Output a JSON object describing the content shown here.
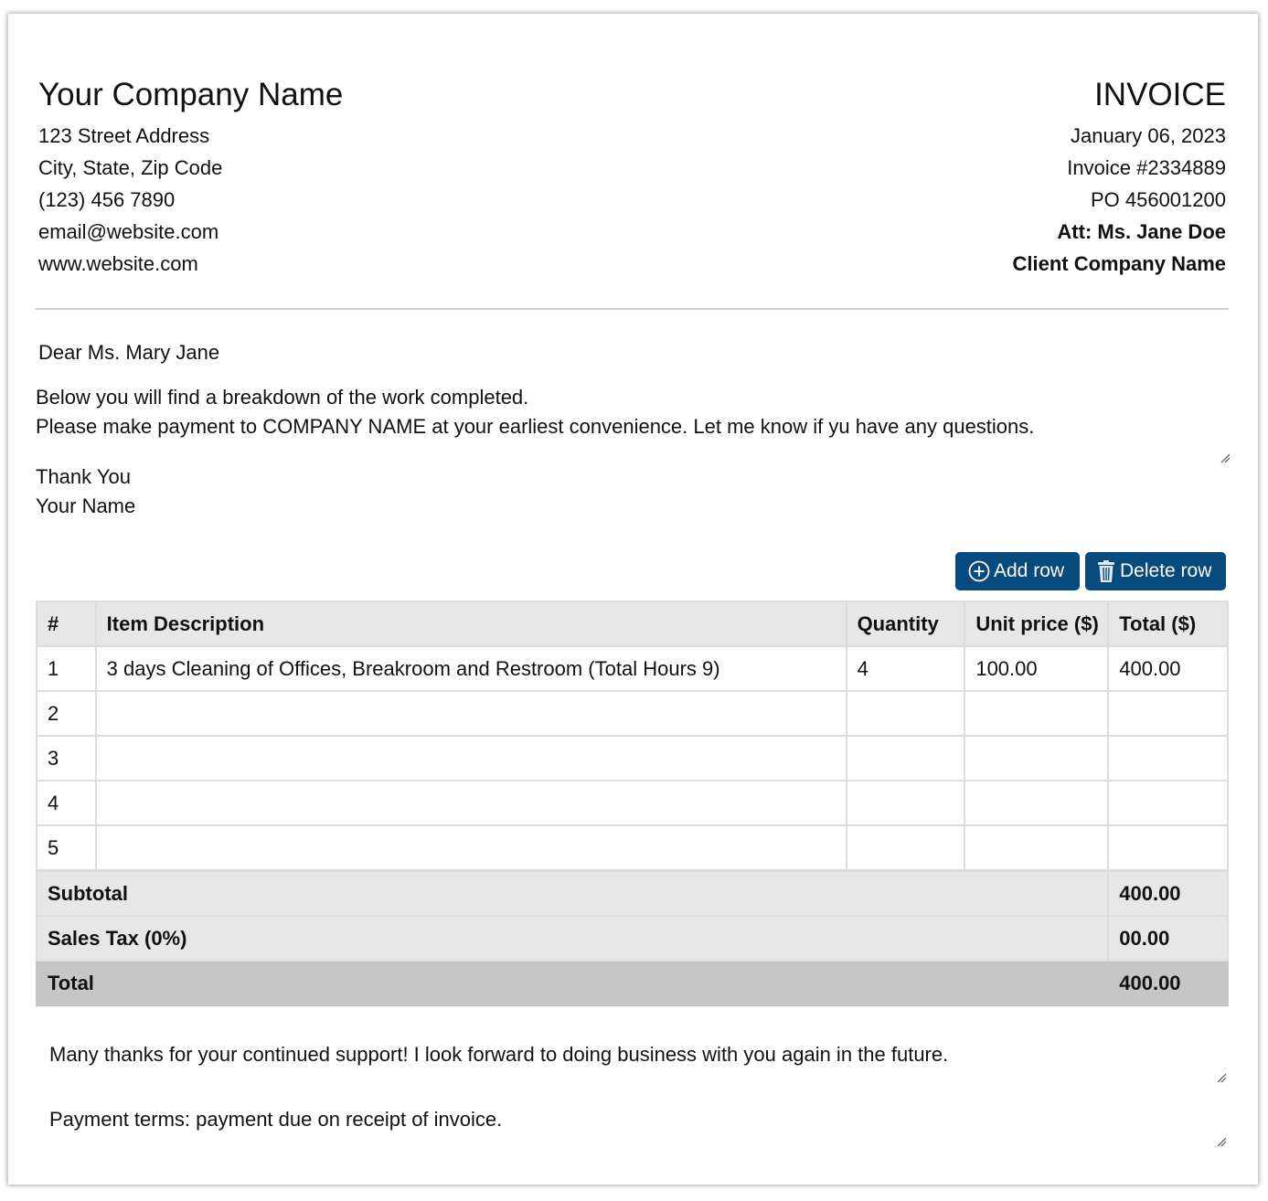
{
  "header": {
    "company_name": "Your Company Name",
    "company_lines": [
      "123 Street Address",
      "City, State, Zip Code",
      "(123) 456 7890",
      "email@website.com",
      "www.website.com"
    ],
    "title": "INVOICE",
    "date": "January 06, 2023",
    "invoice_number": "Invoice #2334889",
    "po_number": "PO 456001200",
    "attention": "Att: Ms. Jane Doe",
    "client_company": "Client Company Name"
  },
  "letter": {
    "greeting": "Dear Ms. Mary Jane",
    "message_lines": [
      "Below you will find a breakdown of the work completed.",
      "Please make payment to COMPANY NAME at your earliest convenience. Let me know if yu have any questions."
    ],
    "signoff_lines": [
      "Thank You",
      "Your Name"
    ]
  },
  "toolbar": {
    "add_row_label": "Add row",
    "delete_row_label": "Delete row",
    "add_icon": "plus-circle-icon",
    "delete_icon": "trash-icon",
    "button_color": "#064a7e"
  },
  "table": {
    "headers": [
      "#",
      "Item Description",
      "Quantity",
      "Unit price ($)",
      "Total ($)"
    ],
    "rows": [
      {
        "num": "1",
        "description": "3 days Cleaning of Offices, Breakroom and Restroom (Total Hours 9)",
        "quantity": "4",
        "unit_price": "100.00",
        "total": "400.00"
      },
      {
        "num": "2",
        "description": "",
        "quantity": "",
        "unit_price": "",
        "total": ""
      },
      {
        "num": "3",
        "description": "",
        "quantity": "",
        "unit_price": "",
        "total": ""
      },
      {
        "num": "4",
        "description": "",
        "quantity": "",
        "unit_price": "",
        "total": ""
      },
      {
        "num": "5",
        "description": "",
        "quantity": "",
        "unit_price": "",
        "total": ""
      }
    ],
    "subtotal_label": "Subtotal",
    "subtotal_value": "400.00",
    "tax_label": "Sales Tax (0%)",
    "tax_value": "00.00",
    "total_label": "Total",
    "total_value": "400.00"
  },
  "footer": {
    "thanks_note": "Many thanks for your continued support! I look forward to doing business with you again in the future.",
    "payment_terms": "Payment terms: payment due on receipt of invoice."
  }
}
